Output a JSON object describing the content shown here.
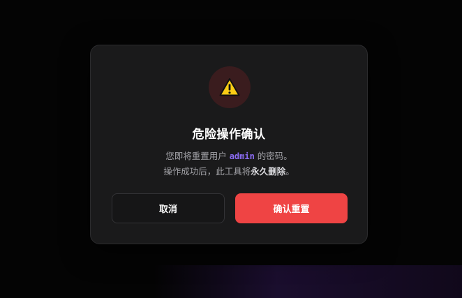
{
  "dialog": {
    "title": "危险操作确认",
    "line1_prefix": "您即将重置用户 ",
    "username": "admin",
    "line1_suffix": " 的密码。",
    "line2_prefix": "操作成功后，此工具将",
    "line2_strong": "永久删除",
    "line2_suffix": "。",
    "cancel_label": "取消",
    "confirm_label": "确认重置",
    "icon": "warning-triangle-icon"
  },
  "colors": {
    "accent_danger": "#ef4444",
    "username_highlight": "#8b6cf2",
    "warning_yellow": "#facc15",
    "modal_bg": "#1a1a1b"
  }
}
